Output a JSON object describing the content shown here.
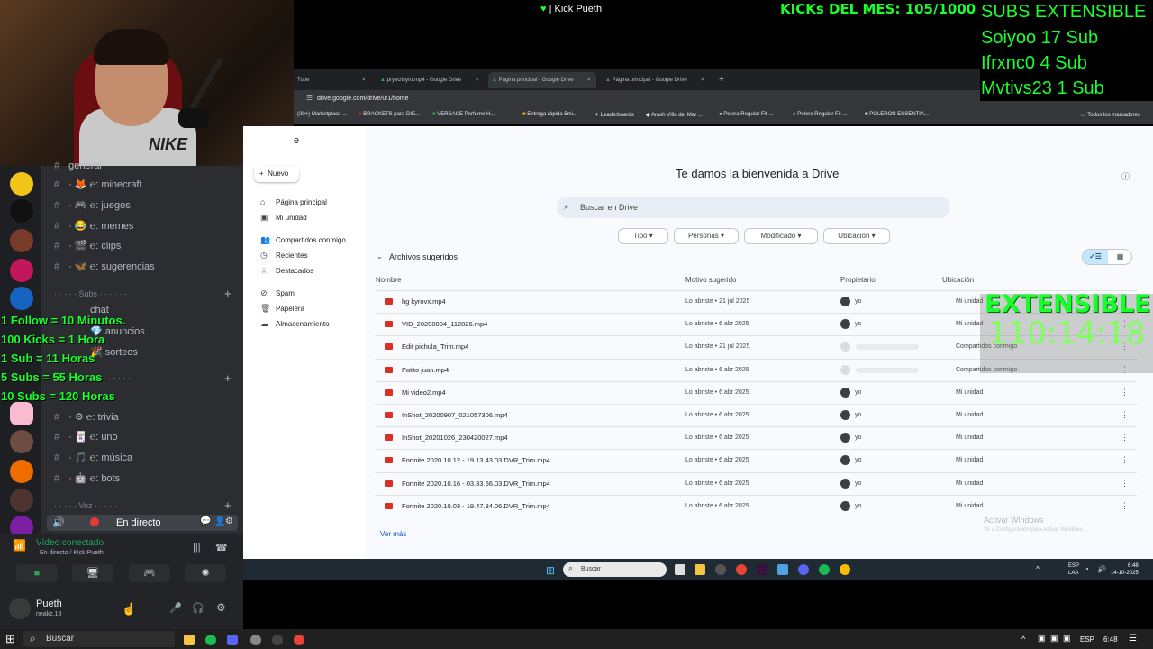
{
  "stream": {
    "title": "| Kick Pueth",
    "kicks_month": "KICKs DEL MES: 105/1000",
    "subs_header": "SUBS EXTENSIBLE",
    "subs": [
      "Soiyoo 17 Sub",
      "Ifrxnc0 4 Sub",
      "Mvtivs23 1 Sub"
    ],
    "extensible_title": "EXTENSIBLE",
    "extensible_timer": "110:14:18",
    "rules": [
      "1 Follow = 10 Minutos.",
      "100 Kicks = 1 Hora",
      "1 Sub = 11 Horas",
      "5 Subs = 55 Horas",
      "10 Subs = 120 Horas"
    ],
    "webcam_shirt": "NIKE"
  },
  "discord": {
    "channels_top": [
      {
        "name": "general"
      },
      {
        "name": "minecraft"
      },
      {
        "name": "juegos"
      },
      {
        "name": "memes"
      },
      {
        "name": "clips"
      },
      {
        "name": "sugerencias"
      }
    ],
    "category_subs": "Subs",
    "channels_subs": [
      {
        "name": "chat"
      },
      {
        "name": "anuncios"
      },
      {
        "name": "sorteos"
      }
    ],
    "channels_mid": [
      {
        "name": "trivia"
      },
      {
        "name": "uno"
      },
      {
        "name": "música"
      },
      {
        "name": "bots"
      }
    ],
    "category_voz": "Voz",
    "voice_channel": "En directo",
    "voice_status": "Vídeo conectado",
    "voice_sub": "En directo / Kick Pueth",
    "user_name": "Pueth",
    "user_tag": "neakz.18"
  },
  "browser": {
    "tabs": [
      "Tube",
      "pryecllsyro.mp4 - Google Drive",
      "Página principal - Google Drive",
      "Página principal - Google Drive"
    ],
    "url": "drive.google.com/drive/u/1/home",
    "bookmarks": [
      "(20+) Marketplace ...",
      "BRACKETS para DIE...",
      "VERSACE Perfume H...",
      "Entrega rápida 5mi...",
      "Leaderboards",
      "Arash Villa del Mar ...",
      "Polera Regular Fit ...",
      "Polera Regular Fit ...",
      "POLERON ESSENTIA..."
    ],
    "bookmarks_all": "Todos los marcadores"
  },
  "drive": {
    "new_label": "Nuevo",
    "nav": [
      "Página principal",
      "Mi unidad",
      "Compartidos conmigo",
      "Recientes",
      "Destacados",
      "Spam",
      "Papelera",
      "Almacenamiento"
    ],
    "welcome": "Te damos la bienvenida a Drive",
    "search_placeholder": "Buscar en Drive",
    "chips": [
      "Tipo",
      "Personas",
      "Modificado",
      "Ubicación"
    ],
    "suggested": "Archivos sugeridos",
    "columns": {
      "name": "Nombre",
      "reason": "Motivo sugerido",
      "owner": "Propietario",
      "location": "Ubicación"
    },
    "files": [
      {
        "name": "hg kyrovx.mp4",
        "reason": "Lo abriste • 21 jul 2025",
        "owner": "yo",
        "location": "Mi unidad"
      },
      {
        "name": "VID_20200804_112826.mp4",
        "reason": "Lo abriste • 6 abr 2025",
        "owner": "yo",
        "location": "Mi unidad"
      },
      {
        "name": "Edit pichula_Trim.mp4",
        "reason": "Lo abriste • 21 jul 2025",
        "owner": "",
        "location": "Compartidos conmigo"
      },
      {
        "name": "Patito juan.mp4",
        "reason": "Lo abriste • 6 abr 2025",
        "owner": "",
        "location": "Compartidos conmigo"
      },
      {
        "name": "Mi video2.mp4",
        "reason": "Lo abriste • 6 abr 2025",
        "owner": "yo",
        "location": "Mi unidad"
      },
      {
        "name": "InShot_20200907_021057306.mp4",
        "reason": "Lo abriste • 6 abr 2025",
        "owner": "yo",
        "location": "Mi unidad"
      },
      {
        "name": "InShot_20201026_230420027.mp4",
        "reason": "Lo abriste • 6 abr 2025",
        "owner": "yo",
        "location": "Mi unidad"
      },
      {
        "name": "Fortnite 2020.10.12 - 19.13.43.03.DVR_Trim.mp4",
        "reason": "Lo abriste • 6 abr 2025",
        "owner": "yo",
        "location": "Mi unidad"
      },
      {
        "name": "Fortnite 2020.10.16 - 03.33.56.03.DVR_Trim.mp4",
        "reason": "Lo abriste • 6 abr 2025",
        "owner": "yo",
        "location": "Mi unidad"
      },
      {
        "name": "Fortnite 2020.10.03 - 19.47.34.06.DVR_Trim.mp4",
        "reason": "Lo abriste • 6 abr 2025",
        "owner": "yo",
        "location": "Mi unidad"
      }
    ],
    "see_more": "Ver más",
    "activate_windows": "Activar Windows",
    "activate_windows_sub": "Ve a Configuración para activar Windows."
  },
  "inner_taskbar": {
    "search": "Buscar",
    "lang": "ESP",
    "lang_sub": "LAA",
    "time": "6:48",
    "date": "14-10-2025"
  },
  "outer_taskbar": {
    "search": "Buscar",
    "lang": "ESP",
    "time": "6:48"
  },
  "colors": {
    "overlay_green": "#18ff2c",
    "discord_bg": "#2b2d31",
    "drive_bg": "#f8fafd"
  }
}
